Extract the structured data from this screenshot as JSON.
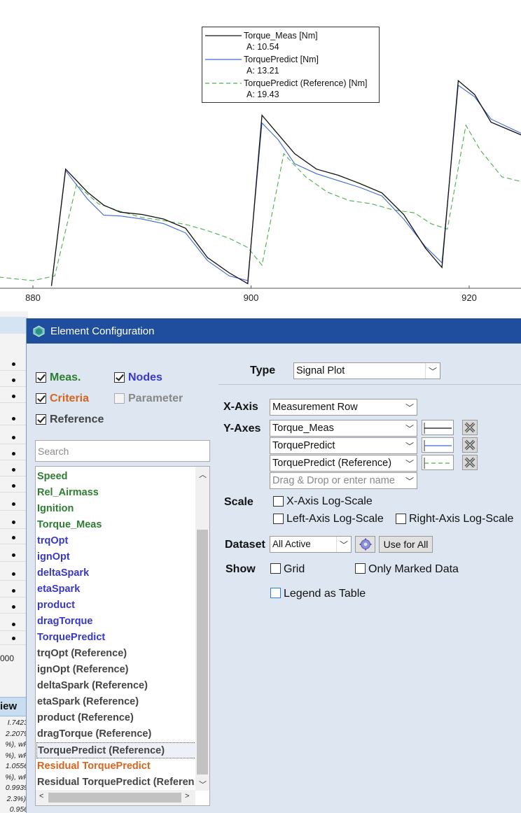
{
  "chart": {
    "x_ticks": [
      "880",
      "900",
      "920"
    ],
    "legend": [
      {
        "name": "Torque_Meas [Nm]",
        "value": "A: 10.54",
        "color": "#111111",
        "dash": "solid"
      },
      {
        "name": "TorquePredict [Nm]",
        "value": "A: 13.21",
        "color": "#4169d6",
        "dash": "solid"
      },
      {
        "name": "TorquePredict (Reference) [Nm]",
        "value": "A: 19.43",
        "color": "#4bb04b",
        "dash": "dashed"
      }
    ]
  },
  "chart_data": {
    "type": "line",
    "xlim": [
      870,
      925
    ],
    "xticks": [
      880,
      900,
      920
    ],
    "series": [
      {
        "name": "Torque_Meas [Nm]",
        "color": "#111111",
        "x": [
          870,
          871.5,
          872.5,
          875,
          877,
          878.5,
          880,
          881.7,
          883,
          885,
          886.5,
          888,
          890,
          892,
          894,
          896,
          898,
          899.7,
          901,
          902.5,
          904,
          906,
          908,
          910,
          912,
          914,
          916,
          917.5,
          919,
          920.5,
          922,
          925
        ],
        "y": [
          null,
          0.7,
          0.65,
          null,
          null,
          null,
          null,
          0.3,
          15.5,
          12.5,
          10.8,
          9.9,
          9.6,
          9.0,
          7.8,
          4.0,
          2.0,
          0.6,
          22.5,
          20,
          17.5,
          15.5,
          14.7,
          13.6,
          12.4,
          9.6,
          5.2,
          2.7,
          27.0,
          25.2,
          21.6,
          19.8
        ]
      },
      {
        "name": "TorquePredict [Nm]",
        "color": "#4169d6",
        "x": [
          872.5,
          875,
          877,
          878.5,
          880,
          881.7,
          883,
          885,
          886.5,
          888,
          890,
          892,
          894,
          896,
          898,
          899.7,
          901,
          902.5,
          904,
          906,
          908,
          910,
          912,
          914,
          916,
          917.5,
          919,
          920.5,
          922,
          925
        ],
        "y": [
          0.6,
          null,
          null,
          null,
          null,
          0.35,
          15.3,
          11.6,
          9.5,
          9.4,
          9.0,
          8.4,
          7.2,
          3.6,
          1.6,
          1.0,
          21.5,
          19.3,
          16.2,
          14.9,
          14.0,
          13.1,
          12.0,
          9.0,
          5.4,
          3.3,
          26.4,
          24.9,
          22.0,
          20.0
        ]
      },
      {
        "name": "TorquePredict (Reference) [Nm]",
        "color": "#4bb04b",
        "x": [
          870,
          872,
          874,
          876,
          878.5,
          880,
          882,
          884,
          886,
          888,
          890,
          892,
          894,
          896,
          898,
          899.7,
          901,
          903,
          905,
          907,
          909,
          911,
          913,
          915,
          916.5,
          918,
          919.7,
          921,
          923,
          925
        ],
        "y": [
          3.6,
          2.8,
          2.0,
          1.6,
          1.2,
          1.0,
          1.6,
          13.5,
          11.0,
          10.0,
          9.2,
          8.8,
          8.3,
          7.5,
          6.5,
          5.3,
          3.0,
          17.5,
          14.5,
          12.5,
          11.4,
          11.0,
          10.2,
          9.8,
          8.4,
          7.7,
          21.2,
          18.0,
          14.5,
          13.8
        ]
      }
    ],
    "ylim": [
      0,
      30
    ],
    "grid": false,
    "legend_position": "top-center",
    "xlabel": "",
    "ylabel": ""
  },
  "background_panel": {
    "x_label": "000",
    "view_label": "iew",
    "fragments": [
      "I.7423",
      "2.2079",
      "%), wF",
      "%), wF",
      "1.0556",
      "%), wF",
      "0.9939",
      "2.3%),",
      "0.956"
    ]
  },
  "dialog": {
    "title": "Element Configuration",
    "filters": [
      {
        "label": "Meas.",
        "checked": true,
        "color": "#2e7d32"
      },
      {
        "label": "Nodes",
        "checked": true,
        "color": "#3838c8"
      },
      {
        "label": "Criteria",
        "checked": true,
        "color": "#d8641e"
      },
      {
        "label": "Parameter",
        "checked": false,
        "color": "#888888"
      },
      {
        "label": "Reference",
        "checked": true,
        "color": "#444444"
      }
    ],
    "search_placeholder": "Search",
    "list_items": [
      {
        "label": "Speed",
        "color": "#2e7d32"
      },
      {
        "label": "Rel_Airmass",
        "color": "#2e7d32"
      },
      {
        "label": "Ignition",
        "color": "#2e7d32"
      },
      {
        "label": "Torque_Meas",
        "color": "#2e7d32"
      },
      {
        "label": "trqOpt",
        "color": "#3838c8"
      },
      {
        "label": "ignOpt",
        "color": "#3838c8"
      },
      {
        "label": "deltaSpark",
        "color": "#3838c8"
      },
      {
        "label": "etaSpark",
        "color": "#3838c8"
      },
      {
        "label": "product",
        "color": "#3838c8"
      },
      {
        "label": "dragTorque",
        "color": "#3838c8"
      },
      {
        "label": "TorquePredict",
        "color": "#3838c8"
      },
      {
        "label": "trqOpt (Reference)",
        "color": "#444444"
      },
      {
        "label": "ignOpt (Reference)",
        "color": "#444444"
      },
      {
        "label": "deltaSpark (Reference)",
        "color": "#444444"
      },
      {
        "label": "etaSpark (Reference)",
        "color": "#444444"
      },
      {
        "label": "product (Reference)",
        "color": "#444444"
      },
      {
        "label": "dragTorque (Reference)",
        "color": "#444444"
      },
      {
        "label": "TorquePredict (Reference)",
        "color": "#444444",
        "selected": true
      },
      {
        "label": "Residual TorquePredict",
        "color": "#d8641e"
      },
      {
        "label": "Residual TorquePredict (Referen",
        "color": "#444444"
      }
    ],
    "type_label": "Type",
    "type_value": "Signal Plot",
    "xaxis_label": "X-Axis",
    "xaxis_value": "Measurement Row",
    "yaxes_label": "Y-Axes",
    "yaxes": [
      {
        "value": "Torque_Meas",
        "color": "#111111",
        "dash": "solid"
      },
      {
        "value": "TorquePredict",
        "color": "#4169d6",
        "dash": "solid"
      },
      {
        "value": "TorquePredict (Reference)",
        "color": "#4bb04b",
        "dash": "dashed"
      }
    ],
    "yaxes_placeholder": "Drag & Drop or enter name",
    "scale_label": "Scale",
    "scale_options": [
      {
        "label": "X-Axis Log-Scale",
        "checked": false
      },
      {
        "label": "Left-Axis Log-Scale",
        "checked": false
      },
      {
        "label": "Right-Axis Log-Scale",
        "checked": false
      }
    ],
    "dataset_label": "Dataset",
    "dataset_value": "All Active",
    "use_for_all": "Use for All",
    "show_label": "Show",
    "show_options": [
      {
        "label": "Grid",
        "checked": false
      },
      {
        "label": "Only Marked Data",
        "checked": false
      },
      {
        "label": "Legend as Table",
        "checked": false
      }
    ]
  }
}
